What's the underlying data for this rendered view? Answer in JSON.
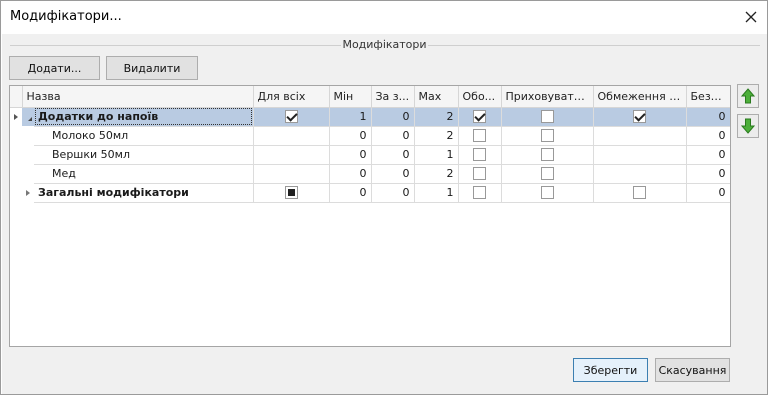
{
  "window": {
    "title": "Модифікатори..."
  },
  "group": {
    "title": "Модифікатори"
  },
  "toolbar": {
    "add_label": "Додати...",
    "delete_label": "Видалити"
  },
  "columns": [
    "Назва",
    "Для всіх",
    "Мін",
    "За з...",
    "Max",
    "Обо...",
    "Приховувати,...",
    "Обмеження на...",
    "Безк..."
  ],
  "rows": [
    {
      "name": "Додатки до напоїв",
      "for_all": "checked",
      "min": "1",
      "za": "0",
      "max": "2",
      "obo": "checked",
      "hide": "unchecked",
      "limit": "checked",
      "free": "0"
    },
    {
      "name": "Молоко 50мл",
      "for_all": "none",
      "min": "0",
      "za": "0",
      "max": "2",
      "obo": "unchecked",
      "hide": "unchecked",
      "limit": "none",
      "free": "0"
    },
    {
      "name": "Вершки 50мл",
      "for_all": "none",
      "min": "0",
      "za": "0",
      "max": "1",
      "obo": "unchecked",
      "hide": "unchecked",
      "limit": "none",
      "free": "0"
    },
    {
      "name": "Мед",
      "for_all": "none",
      "min": "0",
      "za": "0",
      "max": "2",
      "obo": "unchecked",
      "hide": "unchecked",
      "limit": "none",
      "free": "0"
    },
    {
      "name": "Загальні модифікатори",
      "for_all": "indeterminate",
      "min": "0",
      "za": "0",
      "max": "1",
      "obo": "unchecked",
      "hide": "unchecked",
      "limit": "unchecked",
      "free": "0"
    }
  ],
  "footer": {
    "save_label": "Зберегти",
    "cancel_label": "Скасування"
  },
  "icons": {
    "close": "close-icon",
    "up": "arrow-up-icon",
    "down": "arrow-down-icon"
  },
  "colors": {
    "selection": "#b9cbe2",
    "arrow_green": "#3a9a2c"
  }
}
